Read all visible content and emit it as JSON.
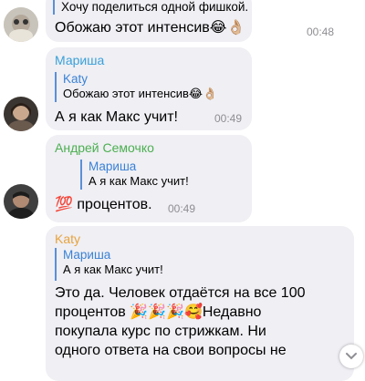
{
  "messages": [
    {
      "reply_text": "Хочу поделиться одной фишкой. Может ко...",
      "text": "Обожаю этот интенсив",
      "time": "00:48"
    },
    {
      "sender": "Мариша",
      "reply_name": "Katy",
      "reply_text": "Обожаю этот интенсив",
      "text": "А я как Макс учит!",
      "time": "00:49"
    },
    {
      "sender": "Андрей Семочко",
      "reply_name": "Мариша",
      "reply_text": "А я как Макс учит!",
      "text": "процентов.",
      "time": "00:49"
    },
    {
      "sender": "Katy",
      "reply_name": "Мариша",
      "reply_text": "А я как Макс учит!",
      "lines": [
        "Это да. Человек отдаётся на все 100",
        "процентов",
        "Недавно",
        "покупала курс по стрижкам. Ни",
        "одного ответа на свои вопросы не"
      ]
    }
  ],
  "colors": {
    "sender_marisha": "#3aa0d8",
    "sender_andrey": "#4caf50",
    "sender_katy": "#e8a33d",
    "quote_bar": "#5b8fd6",
    "bubble_bg": "#efeff4",
    "time": "#8e8e93"
  },
  "icons": [
    "laughing-emoji",
    "ok-hand-emoji",
    "hundred-emoji",
    "party-popper-emoji",
    "smiling-face-hearts-emoji",
    "scroll-down-icon"
  ]
}
